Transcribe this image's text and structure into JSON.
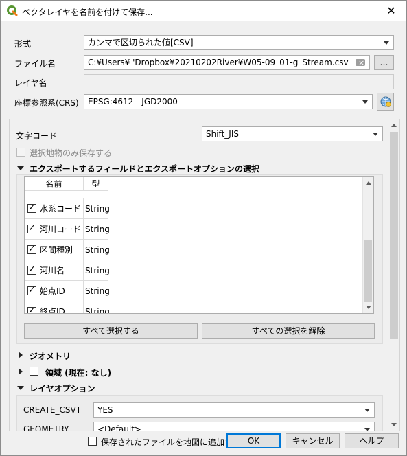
{
  "window": {
    "title": "ベクタレイヤを名前を付けて保存...",
    "close_glyph": "✕"
  },
  "form": {
    "format_label": "形式",
    "format_value": "カンマで区切られた値[CSV]",
    "filename_label": "ファイル名",
    "filename_value": "C:¥Users¥        'Dropbox¥20210202River¥W05-09_01-g_Stream.csv",
    "browse_label": "…",
    "layername_label": "レイヤ名",
    "layername_value": "",
    "crs_label": "座標参照系(CRS)",
    "crs_value": "EPSG:4612 - JGD2000"
  },
  "options": {
    "encoding_label": "文字コード",
    "encoding_value": "Shift_JIS",
    "selected_only_label": "選択地物のみ保存する",
    "fields_section_title": "エクスポートするフィールドとエクスポートオプションの選択",
    "table_headers": [
      "名前",
      "型"
    ],
    "fields": [
      {
        "name": "水系コード",
        "type": "String",
        "checked": true
      },
      {
        "name": "河川コード",
        "type": "String",
        "checked": true
      },
      {
        "name": "区間種別",
        "type": "String",
        "checked": true
      },
      {
        "name": "河川名",
        "type": "String",
        "checked": true
      },
      {
        "name": "始点ID",
        "type": "String",
        "checked": true
      },
      {
        "name": "終点ID",
        "type": "String",
        "checked": true
      }
    ],
    "select_all_label": "すべて選択する",
    "deselect_all_label": "すべての選択を解除",
    "geometry_section": "ジオメトリ",
    "extent_section": "領域 (現在: なし)",
    "layer_options_section": "レイヤオプション",
    "layer_options": [
      {
        "key": "CREATE_CSVT",
        "value": "YES"
      },
      {
        "key": "GEOMETRY",
        "value": "<Default>"
      }
    ]
  },
  "footer": {
    "add_to_map_label": "保存されたファイルを地図に追加する",
    "ok_label": "OK",
    "cancel_label": "キャンセル",
    "help_label": "ヘルプ"
  }
}
